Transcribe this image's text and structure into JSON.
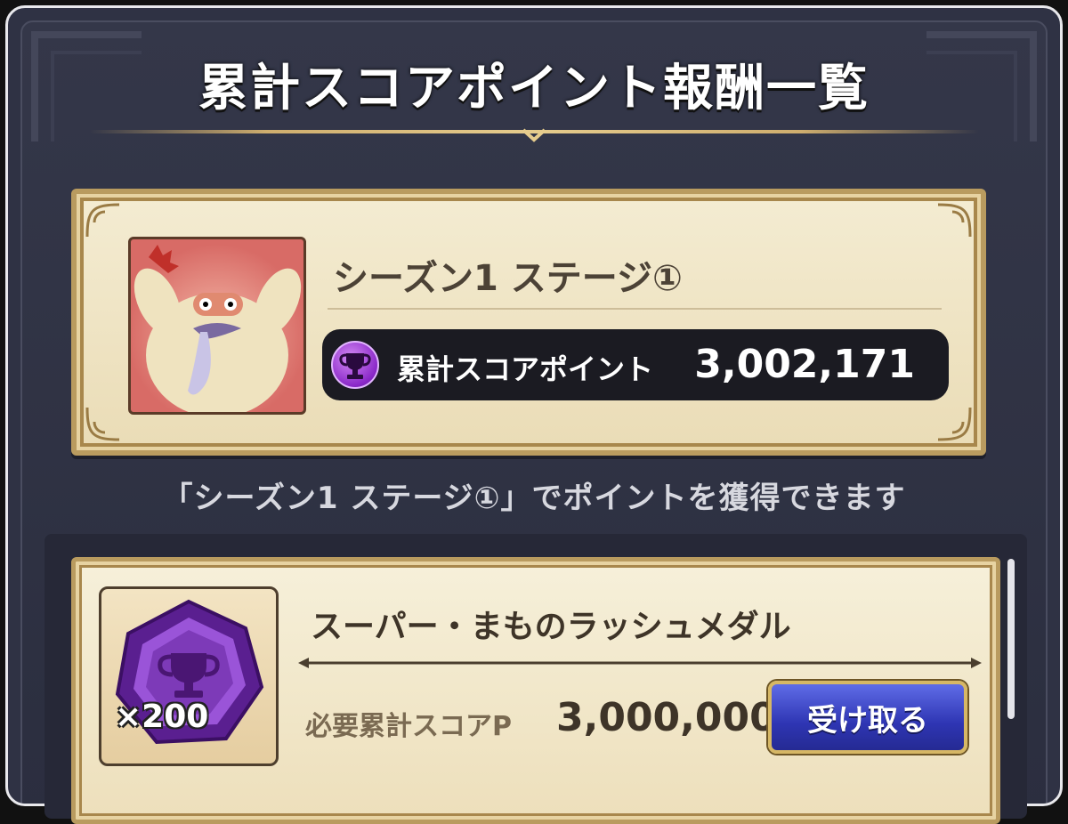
{
  "page": {
    "title": "累計スコアポイント報酬一覧"
  },
  "stage": {
    "name": "シーズン1 ステージ①",
    "score_label": "累計スコアポイント",
    "score_value": "3,002,171",
    "info_text": "「シーズン1 ステージ①」でポイントを獲得できます"
  },
  "rewards": [
    {
      "name": "スーパー・まものラッシュメダル",
      "quantity": "×200",
      "required_label": "必要累計スコアP",
      "required_value": "3,000,000",
      "button_label": "受け取る"
    }
  ],
  "colors": {
    "panel_bg": "#2f3244",
    "parchment": "#f4ecd2",
    "gold_border": "#b99b5f",
    "button_blue": "#2e35b3",
    "trophy_purple": "#8a28c8"
  },
  "icons": {
    "stage_thumbnail": "yeti-monster-icon",
    "score_badge": "trophy-icon",
    "reward_item": "purple-medal-icon"
  }
}
